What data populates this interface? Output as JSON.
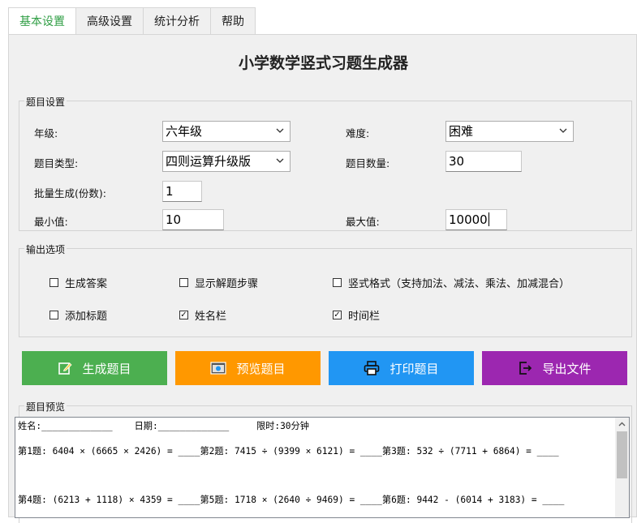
{
  "tabs": [
    "基本设置",
    "高级设置",
    "统计分析",
    "帮助"
  ],
  "app_title": "小学数学竖式习题生成器",
  "question_settings": {
    "legend": "题目设置",
    "grade_label": "年级:",
    "grade_value": "六年级",
    "difficulty_label": "难度:",
    "difficulty_value": "困难",
    "type_label": "题目类型:",
    "type_value": "四则运算升级版",
    "count_label": "题目数量:",
    "count_value": "30",
    "batch_label": "批量生成(份数):",
    "batch_value": "1",
    "min_label": "最小值:",
    "min_value": "10",
    "max_label": "最大值:",
    "max_value": "10000"
  },
  "output_options": {
    "legend": "输出选项",
    "generate_answer": {
      "label": "生成答案",
      "checked": false
    },
    "show_steps": {
      "label": "显示解题步骤",
      "checked": false
    },
    "vertical_format": {
      "label": "竖式格式（支持加法、减法、乘法、加减混合）",
      "checked": false
    },
    "add_title": {
      "label": "添加标题",
      "checked": false
    },
    "name_field": {
      "label": "姓名栏",
      "checked": true
    },
    "time_field": {
      "label": "时间栏",
      "checked": true
    }
  },
  "buttons": {
    "generate": {
      "label": "生成题目",
      "color": "#4caf50"
    },
    "preview": {
      "label": "预览题目",
      "color": "#ff9800"
    },
    "print": {
      "label": "打印题目",
      "color": "#2196f3"
    },
    "export": {
      "label": "导出文件",
      "color": "#9c27b0"
    }
  },
  "preview": {
    "legend": "题目预览",
    "header_line": "姓名:_____________    日期:_____________     限时:30分钟",
    "line1": "第1题: 6404 × (6665 × 2426) = ____第2题: 7415 ÷ (9399 × 6121) = ____第3题: 532 ÷ (7711 + 6864) = ____",
    "line2": "第4题: (6213 + 1118) × 4359 = ____第5题: 1718 × (2640 ÷ 9469) = ____第6题: 9442 - (6014 + 3183) = ____"
  }
}
